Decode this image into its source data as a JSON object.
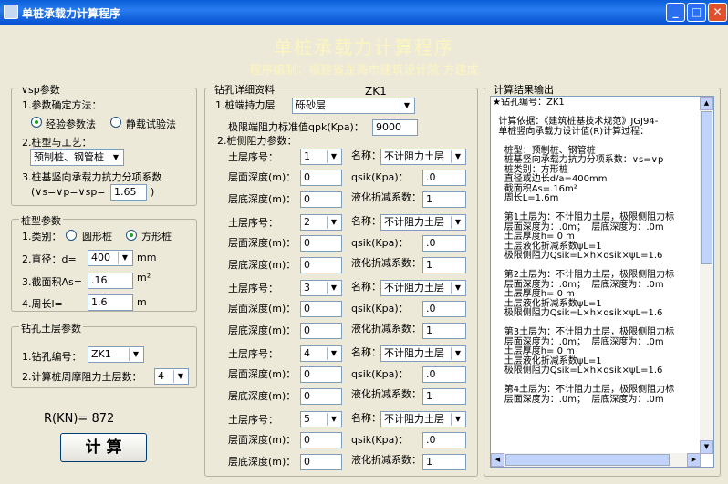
{
  "window": {
    "title": "单桩承载力计算程序",
    "min": "_",
    "max": "□",
    "close": "✕"
  },
  "header": {
    "title": "单桩承载力计算程序",
    "subtitle": "程序编制：福建省龙海市建筑设计院  方建成"
  },
  "sp": {
    "title": "∨sp参数",
    "method_label": "1.参数确定方法：",
    "opt1": "经验参数法",
    "opt2": "静载试验法",
    "pile_label": "2.桩型与工艺：",
    "pile_value": "预制桩、钢管桩",
    "factor_label": "3.桩基竖向承载力抗力分项系数",
    "factor_eq": "(∨s=∨p=∨sp=",
    "factor_value": "1.65",
    "factor_close": ")"
  },
  "ptype": {
    "title": "桩型参数",
    "cat_label": "1.类别：",
    "opt_round": "圆形桩",
    "opt_square": "方形桩",
    "dia_label": "2.直径：d=",
    "dia_value": "400",
    "dia_unit": "mm",
    "area_label": "3.截面积As=",
    "area_value": ".16",
    "area_unit": "m²",
    "peri_label": "4.周长l=",
    "peri_value": "1.6",
    "peri_unit": "m"
  },
  "soil": {
    "title": "钻孔土层参数",
    "hole_label": "1.钻孔编号：",
    "hole_value": "ZK1",
    "count_label": "2.计算桩周摩阻力土层数：",
    "count_value": "4"
  },
  "result": {
    "text": "R(KN)= 872",
    "calc": "计 算"
  },
  "bore": {
    "title": "钻孔详细资料",
    "id": "ZK1",
    "end_label": "1.桩端持力层",
    "end_value": "砾砂层",
    "qpk_label": "极限端阻力标准值qpk(Kpa)：",
    "qpk_value": "9000",
    "side_label": "2.桩侧阻力参数：",
    "row_labels": {
      "no": "土层序号：",
      "top": "层面深度(m)：",
      "bottom": "层底深度(m)：",
      "name": "名称：",
      "qsik": "qsik(Kpa)：",
      "liq": "液化折减系数："
    },
    "layers": [
      {
        "no": "1",
        "top": "0",
        "bottom": "0",
        "name": "不计阻力土层",
        "qsik": ".0",
        "liq": "1"
      },
      {
        "no": "2",
        "top": "0",
        "bottom": "0",
        "name": "不计阻力土层",
        "qsik": ".0",
        "liq": "1"
      },
      {
        "no": "3",
        "top": "0",
        "bottom": "0",
        "name": "不计阻力土层",
        "qsik": ".0",
        "liq": "1"
      },
      {
        "no": "4",
        "top": "0",
        "bottom": "0",
        "name": "不计阻力土层",
        "qsik": ".0",
        "liq": "1"
      },
      {
        "no": "5",
        "top": "0",
        "bottom": "0",
        "name": "不计阻力土层",
        "qsik": ".0",
        "liq": "1"
      }
    ]
  },
  "output": {
    "title": "计算结果输出",
    "text": "★钻孔编号：ZK1\n\n  计算依据：《建筑桩基技术规范》JGJ94-\n  单桩竖向承载力设计值(R)计算过程：\n\n    桩型：预制桩、钢管桩\n    桩基竖向承载力抗力分项系数：∨s=∨p\n    桩类别：方形桩\n    直径或边长d/a=400mm\n    截面积As=.16m²\n    周长L=1.6m\n\n    第1土层为：不计阻力土层，极限侧阻力标\n    层面深度为：.0m；  层底深度为：.0m\n    土层厚度h= 0 m\n    土层液化折减系数ψL=1\n    极限侧阻力Qsik=L×h×qsik×ψL=1.6\n\n    第2土层为：不计阻力土层，极限侧阻力标\n    层面深度为：.0m；  层底深度为：.0m\n    土层厚度h= 0 m\n    土层液化折减系数ψL=1\n    极限侧阻力Qsik=L×h×qsik×ψL=1.6\n\n    第3土层为：不计阻力土层，极限侧阻力标\n    层面深度为：.0m；  层底深度为：.0m\n    土层厚度h= 0 m\n    土层液化折减系数ψL=1\n    极限侧阻力Qsik=L×h×qsik×ψL=1.6\n\n    第4土层为：不计阻力土层，极限侧阻力标\n    层面深度为：.0m；  层底深度为：.0m"
  }
}
